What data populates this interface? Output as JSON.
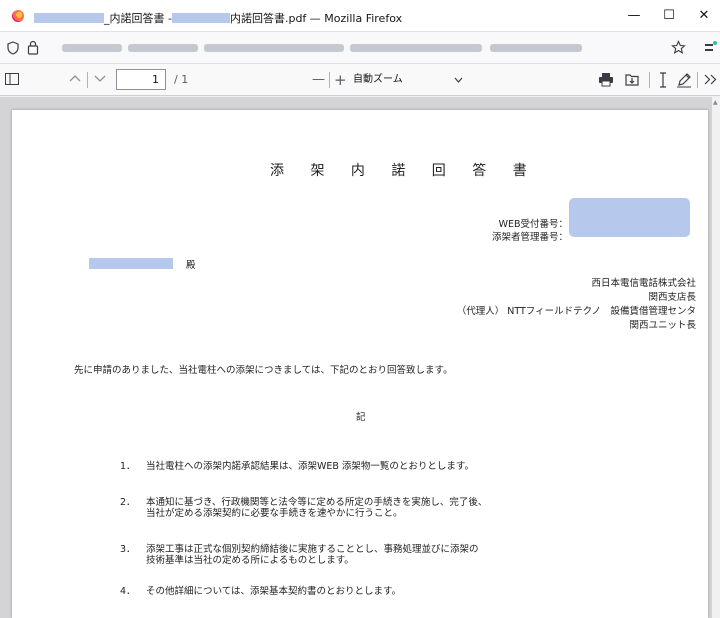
{
  "window": {
    "title_part1": "_内諾回答書 - ",
    "title_part2": "内諾回答書.pdf — Mozilla Firefox",
    "minimize": "—",
    "maximize": "☐",
    "close": "✕"
  },
  "toolbar": {
    "page_number": "1",
    "page_total": "/ 1",
    "zoom_out": "—",
    "zoom_in": "+",
    "zoom_value": "自動ズーム",
    "sidebar_icon": "sidebar-icon",
    "prev_icon": "chevron-up-icon",
    "next_icon": "chevron-down-icon",
    "print_icon": "print-icon",
    "save_icon": "save-icon",
    "text_icon": "text-cursor-icon",
    "draw_icon": "pen-icon",
    "more_icon": "double-chevron-right-icon"
  },
  "document": {
    "title": "添 架 内 諾 回 答 書",
    "web_receipt_label": "WEB受付番号：",
    "manager_number_label": "添架者管理番号：",
    "addressee_suffix": "殿",
    "sender_line1": "西日本電信電話株式会社",
    "sender_line2": "関西支店長",
    "sender_line3": "（代理人） NTTフィールドテクノ　設備賃借管理センタ",
    "sender_line4": "関西ユニット長",
    "intro": "先に申請のありました、当社電柱への添架につきましては、下記のとおり回答致します。",
    "ki": "記",
    "items": [
      {
        "num": "1．",
        "lines": [
          "当社電柱への添架内諾承認結果は、添架WEB 添架物一覧のとおりとします。"
        ]
      },
      {
        "num": "2．",
        "lines": [
          "本通知に基づき、行政機関等と法令等に定める所定の手続きを実施し、完了後、",
          "当社が定める添架契約に必要な手続きを速やかに行うこと。"
        ]
      },
      {
        "num": "3．",
        "lines": [
          "添架工事は正式な個別契約締結後に実施することとし、事務処理並びに添架の",
          "技術基準は当社の定める所によるものとします。"
        ]
      },
      {
        "num": "4．",
        "lines": [
          "その他詳細については、添架基本契約書のとおりとします。"
        ]
      }
    ]
  },
  "colors": {
    "redaction": "#b6c9ec",
    "viewer_bg": "#d4d4d7"
  }
}
